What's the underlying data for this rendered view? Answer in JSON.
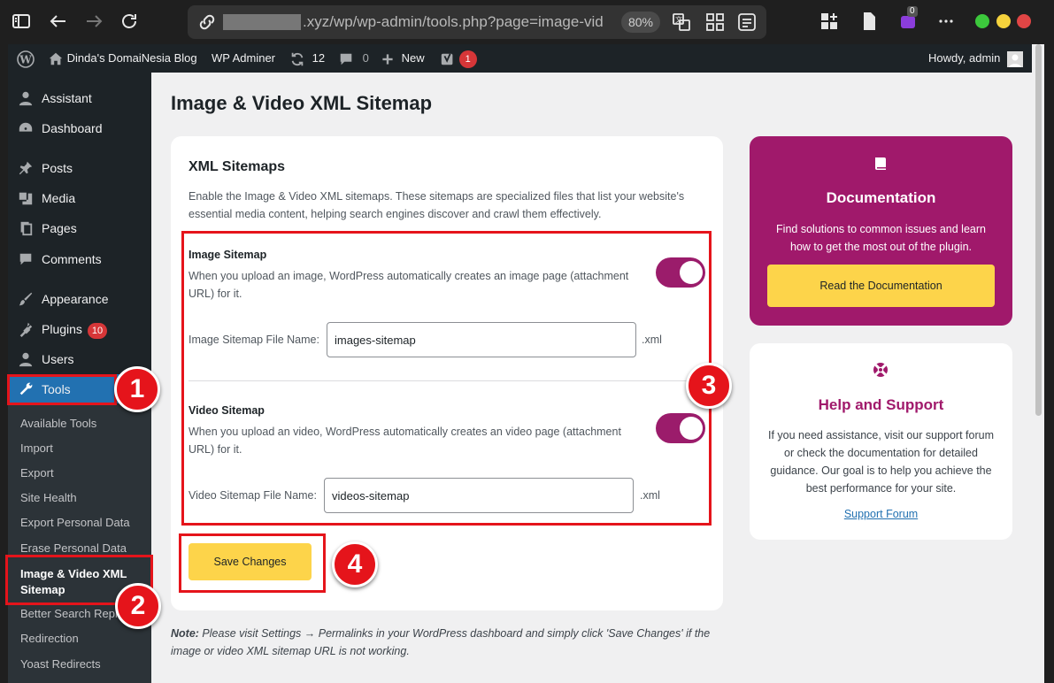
{
  "browser": {
    "url_suffix": ".xyz/wp/wp-admin/tools.php?page=image-vid",
    "zoom": "80%",
    "extension_badge": "0"
  },
  "adminbar": {
    "site_name": "Dinda's DomaiNesia Blog",
    "wp_adminer": "WP Adminer",
    "updates_count": "12",
    "comments_count": "0",
    "new_label": "New",
    "yoast_badge": "1",
    "howdy": "Howdy, admin"
  },
  "sidebar": {
    "items": [
      {
        "label": "Assistant"
      },
      {
        "label": "Dashboard"
      },
      {
        "label": "Posts"
      },
      {
        "label": "Media"
      },
      {
        "label": "Pages"
      },
      {
        "label": "Comments"
      },
      {
        "label": "Appearance"
      },
      {
        "label": "Plugins",
        "badge": "10"
      },
      {
        "label": "Users"
      },
      {
        "label": "Tools"
      }
    ],
    "submenu": [
      "Available Tools",
      "Import",
      "Export",
      "Site Health",
      "Export Personal Data",
      "Erase Personal Data",
      "Image & Video XML Sitemap",
      "Better Search Replace",
      "Redirection",
      "Yoast Redirects"
    ]
  },
  "page": {
    "title": "Image & Video XML Sitemap"
  },
  "card": {
    "title": "XML Sitemaps",
    "description": "Enable the Image & Video XML sitemaps. These sitemaps are specialized files that list your website's essential media content, helping search engines discover and crawl them effectively.",
    "image": {
      "title": "Image Sitemap",
      "description": "When you upload an image, WordPress automatically creates an image page (attachment URL) for it.",
      "field_label": "Image Sitemap File Name:",
      "value": "images-sitemap",
      "ext": ".xml",
      "enabled": true
    },
    "video": {
      "title": "Video Sitemap",
      "description": "When you upload an video, WordPress automatically creates an video page (attachment URL) for it.",
      "field_label": "Video Sitemap File Name:",
      "value": "videos-sitemap",
      "ext": ".xml",
      "enabled": true
    },
    "save_label": "Save Changes"
  },
  "documentation": {
    "title": "Documentation",
    "text": "Find solutions to common issues and learn how to get the most out of the plugin.",
    "button": "Read the Documentation"
  },
  "help": {
    "title": "Help and Support",
    "text": "If you need assistance, visit our support forum or check the documentation for detailed guidance. Our goal is to help you achieve the best performance for your site.",
    "link": "Support Forum"
  },
  "note": {
    "label": "Note:",
    "text": " Please visit Settings → Permalinks in your WordPress dashboard and simply click 'Save Changes' if the image or video XML sitemap URL is not working."
  },
  "annotations": [
    "1",
    "2",
    "3",
    "4"
  ],
  "colors": {
    "accent_magenta": "#a0196b",
    "button_yellow": "#fdd44a",
    "annotation_red": "#e5141b",
    "wp_blue": "#2271b1"
  }
}
